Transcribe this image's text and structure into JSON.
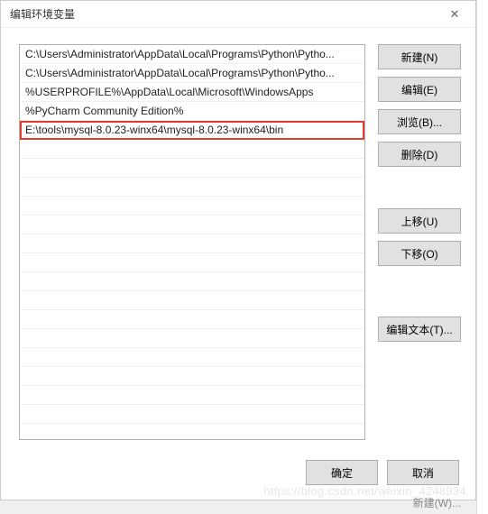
{
  "window": {
    "title": "编辑环境变量",
    "close_icon": "✕"
  },
  "paths": [
    {
      "text": "C:\\Users\\Administrator\\AppData\\Local\\Programs\\Python\\Pytho...",
      "highlight": false
    },
    {
      "text": "C:\\Users\\Administrator\\AppData\\Local\\Programs\\Python\\Pytho...",
      "highlight": false
    },
    {
      "text": "%USERPROFILE%\\AppData\\Local\\Microsoft\\WindowsApps",
      "highlight": false
    },
    {
      "text": "%PyCharm Community Edition%",
      "highlight": false
    },
    {
      "text": "E:\\tools\\mysql-8.0.23-winx64\\mysql-8.0.23-winx64\\bin",
      "highlight": true
    }
  ],
  "buttons": {
    "new": "新建(N)",
    "edit": "编辑(E)",
    "browse": "浏览(B)...",
    "delete": "删除(D)",
    "move_up": "上移(U)",
    "move_down": "下移(O)",
    "edit_text": "编辑文本(T)...",
    "ok": "确定",
    "cancel": "取消"
  },
  "background_button": "新建(W)...",
  "watermark": "https://blog.csdn.net/weixin_4248934"
}
